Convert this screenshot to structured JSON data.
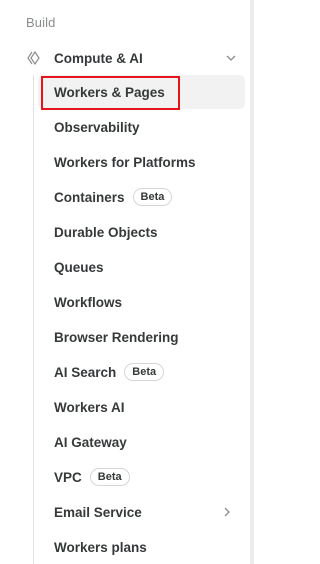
{
  "sidebar": {
    "section_title": "Build",
    "group": {
      "label": "Compute & AI",
      "icon": "compute-icon",
      "expanded": true
    },
    "items": [
      {
        "label": "Workers & Pages",
        "active": true,
        "highlighted": true
      },
      {
        "label": "Observability"
      },
      {
        "label": "Workers for Platforms"
      },
      {
        "label": "Containers",
        "badge": "Beta"
      },
      {
        "label": "Durable Objects"
      },
      {
        "label": "Queues"
      },
      {
        "label": "Workflows"
      },
      {
        "label": "Browser Rendering"
      },
      {
        "label": "AI Search",
        "badge": "Beta"
      },
      {
        "label": "Workers AI"
      },
      {
        "label": "AI Gateway"
      },
      {
        "label": "VPC",
        "badge": "Beta"
      },
      {
        "label": "Email Service",
        "has_submenu": true
      },
      {
        "label": "Workers plans"
      }
    ]
  },
  "colors": {
    "highlight_border": "#e8141b",
    "active_bg": "#f2f2f2",
    "text": "#36393a",
    "muted": "#8a8d90"
  }
}
